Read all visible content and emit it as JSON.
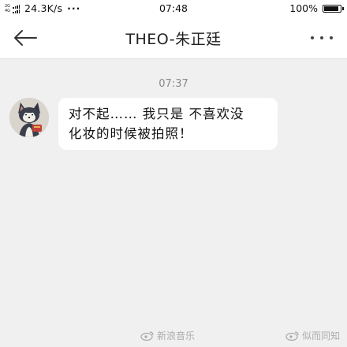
{
  "status_bar": {
    "sim1": "2G",
    "sim2": "4G",
    "speed": "24.3K/s",
    "overflow": "···",
    "time": "07:48",
    "battery": "100%",
    "battery_level": 1.0
  },
  "nav": {
    "title": "THEO-朱正廷",
    "back_icon": "back-arrow-icon",
    "more_icon": "more-dots-icon"
  },
  "chat": {
    "messages": [
      {
        "time": "07:37",
        "line1": "对不起…… 我只是 不喜欢没",
        "line2": "化妆的时候被拍照！"
      }
    ]
  },
  "watermarks": [
    {
      "text": "新浪音乐"
    },
    {
      "text": "似而同知"
    }
  ],
  "colors": {
    "background": "#f0f0f0",
    "bubble": "#ffffff",
    "header": "#ffffff",
    "time_text": "#8a8a8a"
  }
}
